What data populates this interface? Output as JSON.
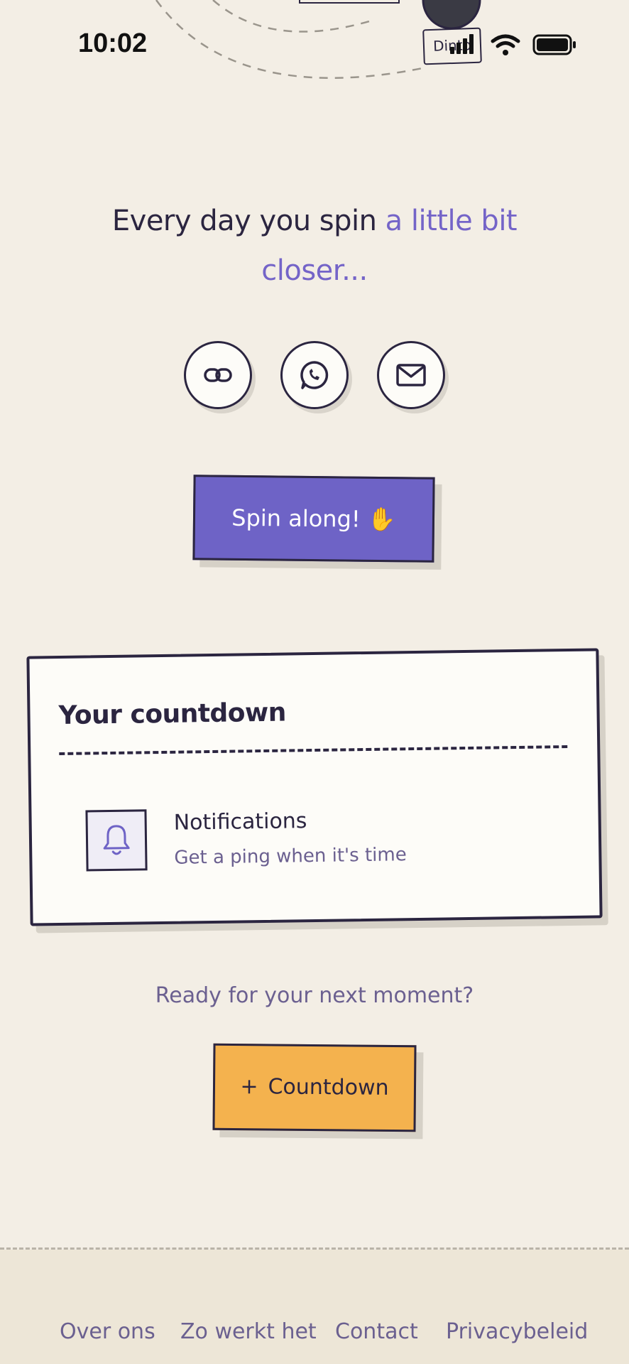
{
  "status_bar": {
    "time": "10:02",
    "icons": [
      "cellular-signal-icon",
      "wifi-icon",
      "battery-icon"
    ]
  },
  "decoration": {
    "tag_label": "Dinto"
  },
  "headline": {
    "part1": "Every day you spin ",
    "accent": "a little bit closer..."
  },
  "share_buttons": [
    {
      "name": "copy-link",
      "icon": "link-icon"
    },
    {
      "name": "whatsapp",
      "icon": "whatsapp-icon"
    },
    {
      "name": "email",
      "icon": "mail-icon"
    }
  ],
  "spin_button": {
    "label": "Spin along! ✋"
  },
  "countdown_card": {
    "title": "Your countdown",
    "notifications": {
      "icon": "bell-icon",
      "title": "Notifications",
      "subtitle": "Get a ping when it's time"
    }
  },
  "ready_text": "Ready for your next moment?",
  "countdown_button": {
    "icon": "+",
    "label": "Countdown"
  },
  "footer": {
    "links": [
      "Over ons",
      "Zo werkt het",
      "Contact",
      "Privacybeleid"
    ]
  },
  "colors": {
    "background": "#f3eee5",
    "accent_purple": "#6e63c6",
    "accent_orange": "#f4b24e",
    "ink": "#2b2540",
    "muted_text": "#6b6090"
  }
}
